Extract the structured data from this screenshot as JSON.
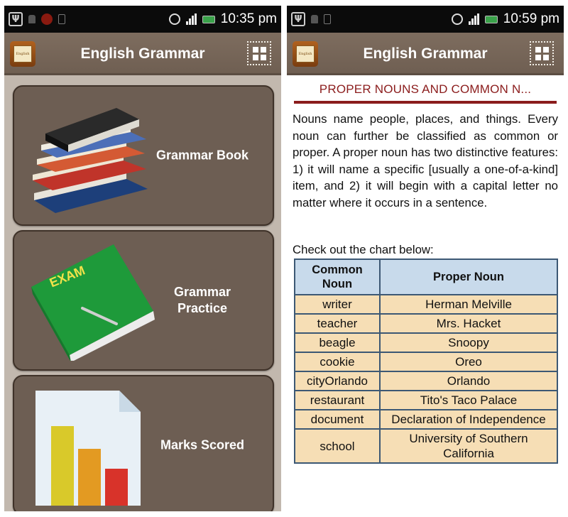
{
  "left_screen": {
    "status_bar": {
      "time": "10:35 pm"
    },
    "app_bar": {
      "title": "English Grammar",
      "logo_text": "English",
      "menu_icon": "grid-icon"
    },
    "menu_items": [
      {
        "label": "Grammar Book",
        "icon": "books-stack-icon"
      },
      {
        "label": "Grammar Practice",
        "icon": "exam-book-icon",
        "icon_text": "EXAM"
      },
      {
        "label": "Marks Scored",
        "icon": "bar-chart-document-icon"
      }
    ]
  },
  "right_screen": {
    "status_bar": {
      "time": "10:59 pm"
    },
    "app_bar": {
      "title": "English Grammar",
      "logo_text": "English",
      "menu_icon": "grid-icon"
    },
    "heading": "PROPER NOUNS AND COMMON N...",
    "paragraph": "Nouns name people, places, and things. Every noun can further be classified as common or proper. A proper noun has two distinctive features: 1) it will name a specific [usually a one-of-a-kind] item, and 2) it will begin with a capital letter no matter where it occurs in a sentence.",
    "chart_intro": "Check out the chart below:",
    "table": {
      "headers": [
        "Common Noun",
        "Proper Noun"
      ],
      "rows": [
        [
          "writer",
          "Herman Melville"
        ],
        [
          "teacher",
          "Mrs. Hacket"
        ],
        [
          "beagle",
          "Snoopy"
        ],
        [
          "cookie",
          "Oreo"
        ],
        [
          "cityOrlando",
          "Orlando"
        ],
        [
          "restaurant",
          "Tito's Taco Palace"
        ],
        [
          "document",
          "Declaration of Independence"
        ],
        [
          "school",
          "University of Southern California"
        ]
      ]
    }
  },
  "colors": {
    "app_bar": "#76665a",
    "menu_card": "#6d5e53",
    "menu_background": "#c2b8ae",
    "heading_red": "#8b1c1c",
    "table_header_bg": "#c8daeb",
    "table_cell_bg": "#f6deb5",
    "table_border": "#3c5874"
  }
}
